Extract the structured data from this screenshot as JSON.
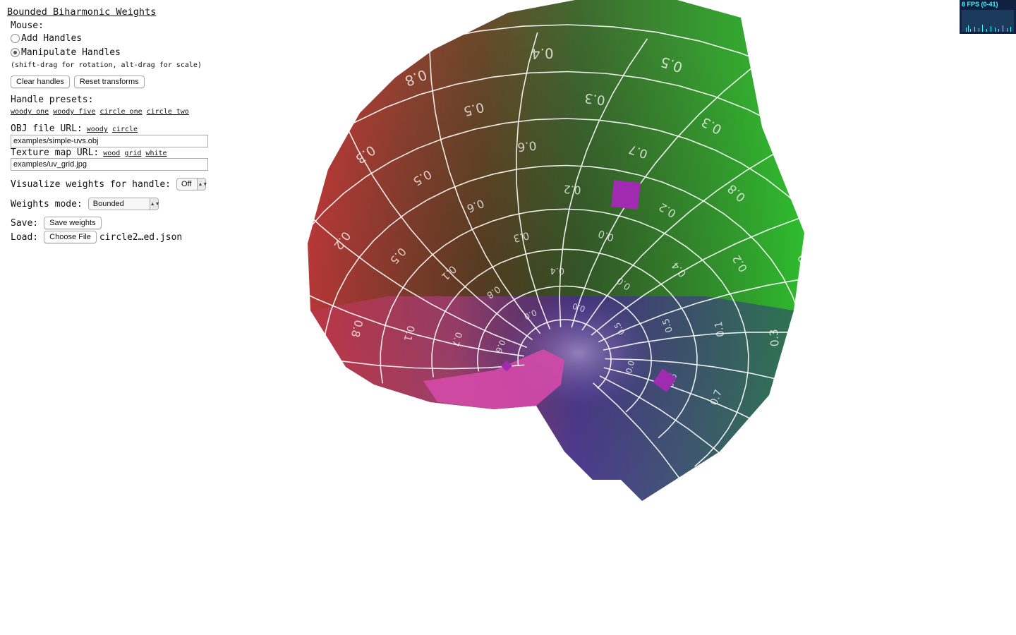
{
  "app": {
    "title": "Bounded Biharmonic Weights"
  },
  "mouse": {
    "label": "Mouse:",
    "options": [
      "Add Handles",
      "Manipulate Handles"
    ],
    "selected": "Manipulate Handles",
    "hint": "(shift-drag for rotation, alt-drag for scale)"
  },
  "buttons": {
    "clear": "Clear handles",
    "reset": "Reset transforms"
  },
  "presets": {
    "label": "Handle presets:",
    "items": [
      "woody one",
      "woody five",
      "circle one",
      "circle two"
    ]
  },
  "obj": {
    "label": "OBJ file URL:",
    "links": [
      "woody",
      "circle"
    ],
    "value": "examples/simple-uvs.obj"
  },
  "texture": {
    "label": "Texture map URL:",
    "links": [
      "wood",
      "grid",
      "white"
    ],
    "value": "examples/uv_grid.jpg"
  },
  "visualize": {
    "label": "Visualize weights for handle:",
    "value": "Off"
  },
  "weights_mode": {
    "label": "Weights mode:",
    "value": "Bounded"
  },
  "save": {
    "label": "Save:",
    "button": "Save weights"
  },
  "load": {
    "label": "Load:",
    "button": "Choose File",
    "filename": "circle2…ed.json"
  },
  "fps": {
    "text": "8 FPS (0-41)"
  },
  "viewport": {
    "colors": {
      "red": "#c43a3a",
      "green": "#2fa82f",
      "blue": "#3b3bcc",
      "pink": "#d04aa0",
      "handle": "#a02ab0"
    },
    "handles": 3,
    "labels": [
      "0.6",
      "0.0",
      "0.0",
      "0.5",
      "0.0",
      "0.7",
      "0.8",
      "0.4",
      "0.0",
      "0.5",
      "0.6",
      "0.1",
      "0.1",
      "0.3",
      "0.0",
      "0.4",
      "0.1",
      "0.7",
      "0.8",
      "0.5",
      "0.6",
      "0.2",
      "0.2",
      "0.2",
      "0.3",
      "0.1",
      "0.4",
      "0.2",
      "0.5",
      "0.6",
      "0.7",
      "0.8",
      "0.9",
      "0.1",
      "0.3",
      "0.1",
      "0.2",
      "0.3",
      "0.5",
      "0.3",
      "0.3",
      "0.3",
      "0.8",
      "0.9",
      "0.5",
      "0.4",
      "0.6",
      "0.7",
      "0.8",
      "0.4",
      "0.5",
      "0.6",
      "0.7",
      "0.5",
      "0.8",
      "0.6"
    ]
  }
}
